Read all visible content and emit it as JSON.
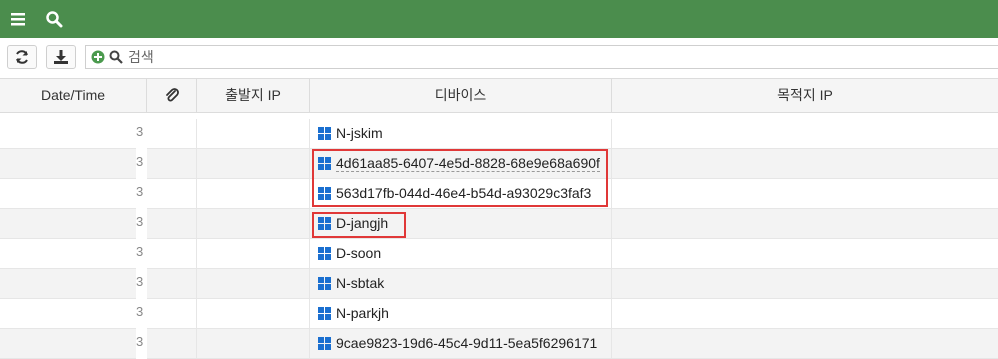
{
  "topbar": {
    "color": "#4b8d4d",
    "icons": [
      "menu-icon",
      "search-icon"
    ]
  },
  "toolbar": {
    "buttons": [
      "refresh-icon",
      "download-icon"
    ],
    "search": {
      "placeholder": "검색",
      "value": ""
    }
  },
  "table": {
    "columns": [
      "Date/Time",
      "",
      "출발지 IP",
      "디바이스",
      "목적지 IP"
    ],
    "attachment_icon": "paperclip-icon",
    "rows": [
      {
        "date_tail": "3",
        "device": "N-jskim"
      },
      {
        "date_tail": "3",
        "device": "4d61aa85-6407-4e5d-8828-68e9e68a690f"
      },
      {
        "date_tail": "3",
        "device": "563d17fb-044d-46e4-b54d-a93029c3faf3"
      },
      {
        "date_tail": "3",
        "device": "D-jangjh"
      },
      {
        "date_tail": "3",
        "device": "D-soon"
      },
      {
        "date_tail": "3",
        "device": "N-sbtak"
      },
      {
        "date_tail": "3",
        "device": "N-parkjh"
      },
      {
        "date_tail": "3",
        "device": "9cae9823-19d6-45c4-9d11-5ea5f6296171"
      }
    ]
  },
  "highlight_color": "#e03838"
}
